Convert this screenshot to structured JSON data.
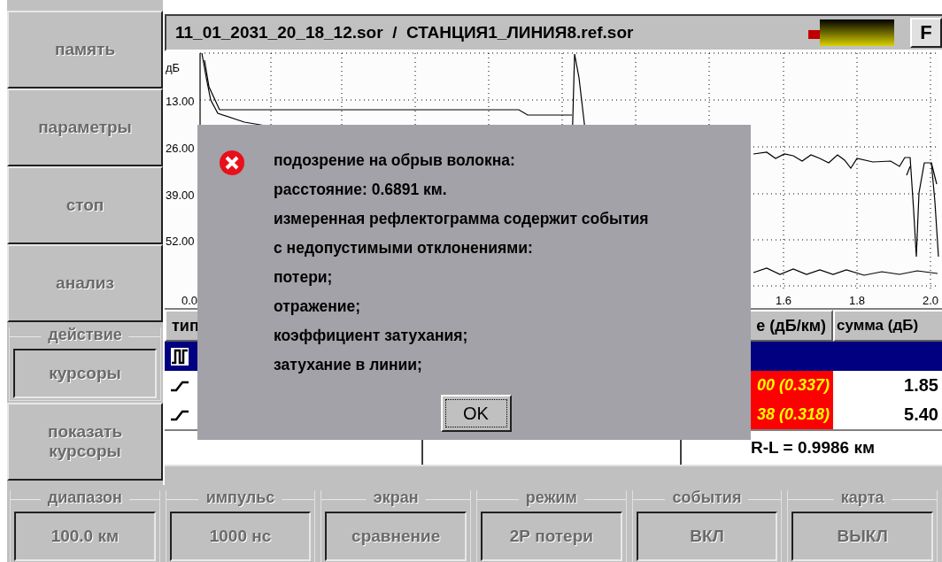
{
  "side_buttons": [
    {
      "label": "память"
    },
    {
      "label": "параметры"
    },
    {
      "label": "стоп"
    },
    {
      "label": "анализ"
    }
  ],
  "action_group": {
    "title": "действие",
    "button": "курсоры"
  },
  "show_cursors": {
    "label": "показать курсоры"
  },
  "title_bar": {
    "filename": "11_01_2031_20_18_12.sor  /  СТАНЦИЯ1_ЛИНИЯ8.ref.sor",
    "f_button": "F"
  },
  "chart": {
    "y_unit": "дБ",
    "y_labels": [
      "13.00",
      "26.00",
      "39.00",
      "52.00"
    ],
    "x_labels": [
      "0.0",
      "1.6",
      "1.8",
      "2.0"
    ]
  },
  "table": {
    "columns": [
      "тип",
      "е (дБ/км)",
      "сумма (дБ)"
    ],
    "rows": [
      {
        "selected": true,
        "kind": "reflective"
      },
      {
        "selected": false,
        "kind": "step",
        "attenuation": "00 (0.337)",
        "flagged": true,
        "sum": "1.85"
      },
      {
        "selected": false,
        "kind": "step",
        "attenuation": "38 (0.318)",
        "flagged": true,
        "sum": "5.40"
      }
    ]
  },
  "cursor_readout": {
    "distance": "R-L = 0.9986 км"
  },
  "bottom_groups": [
    {
      "title": "диапазон",
      "value": "100.0 км"
    },
    {
      "title": "импульс",
      "value": "1000 нс"
    },
    {
      "title": "экран",
      "value": "сравнение"
    },
    {
      "title": "режим",
      "value": "2Р потери"
    },
    {
      "title": "события",
      "value": "ВКЛ"
    },
    {
      "title": "карта",
      "value": "ВЫКЛ"
    }
  ],
  "dialog": {
    "lines": [
      "подозрение на обрыв волокна:",
      "расстояние: 0.6891 км.",
      "измеренная рефлектограмма содержит события",
      "с недопустимыми отклонениями:",
      "потери;",
      "отражение;",
      "коэффициент затухания;",
      "затухание в линии;"
    ],
    "button": "OK"
  }
}
